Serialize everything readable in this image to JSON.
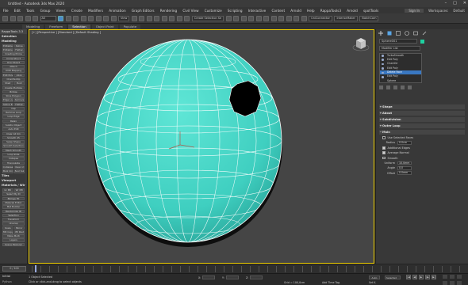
{
  "titlebar": {
    "title": "Untitled - Autodesk 3ds Max 2020"
  },
  "menu": {
    "items": [
      "File",
      "Edit",
      "Tools",
      "Group",
      "Views",
      "Create",
      "Modifiers",
      "Animation",
      "Graph Editors",
      "Rendering",
      "Civil View",
      "Customize",
      "Scripting",
      "Interactive",
      "Content",
      "Arnold",
      "Help",
      "RappaTools3",
      "Arnold",
      "spotTools"
    ],
    "right_items": [
      "Sign In",
      "Workspaces:",
      "Default"
    ]
  },
  "toolbar": {
    "selection_filter": "All",
    "view_combo": "View",
    "selection_set": "Create Selection Se",
    "extra_labels": [
      "UniConnector",
      "InteriorMaker",
      "BatchCam"
    ]
  },
  "ribbon": {
    "tabs": [
      "Modeling",
      "Freeform",
      "Selection",
      "Object Paint",
      "Populate"
    ],
    "active": "Selection"
  },
  "leftpanel": {
    "header": "RappaTools 3.3",
    "selection_title": "Selection",
    "modeling_title": "Modeling",
    "buttons": [
      "Editable Poly",
      "Spline",
      "Editable Mesh",
      "Flatten",
      "Creating Prime",
      "Circle Struct",
      "One Object",
      "Attach",
      "UVW Mapping",
      "Edit Poly",
      "Align",
      "ChamferZip",
      "Shell",
      "Push",
      "Create Multiple",
      "Bridge",
      "Slice Polygon",
      "Edge Loop",
      "Remove Loop",
      "Spline Edge",
      "Flatten",
      "Cap",
      "Remove Loop",
      "Loop Edge",
      "Relax",
      "Subdiv Object",
      "Auto Edit",
      "Clear All Sm",
      "Smooth 45",
      "Swap Shape",
      "Smooth Selection",
      "Mesh Smooth",
      "Loop Slide",
      "Collapse",
      "Triangulate",
      "Collapse",
      "Clean Up",
      "Bool Union",
      "Bool Subtract"
    ],
    "tiles_title": "Tiles",
    "viewport_title": "Viewport",
    "materials_title": "Materials / Wir",
    "mat_buttons": [
      "Gr Mtl",
      "Wr Mtl",
      "Select By ID",
      "Bitmap Fit",
      "Material Editor",
      "Mat Builder",
      "Randomize ID",
      "Selection",
      "Transform",
      "Unwrap",
      "Scale",
      "Mirror",
      "Mtl Copy",
      "Mtl Paste",
      "Make Multi",
      "Layers",
      "Scene Explorer"
    ]
  },
  "viewport": {
    "label": "[+] [Perspective ] [Standard ] [Default Shading ]"
  },
  "rightpanel": {
    "object_name": "Sphere001",
    "object_color": "#1fd0a0",
    "modifier_list": "Modifier List",
    "stack": [
      {
        "name": "TurboSmooth",
        "sel": false,
        "indent": false
      },
      {
        "name": "Edit Poly",
        "sel": false,
        "indent": false
      },
      {
        "name": "Chamfer",
        "sel": false,
        "indent": false
      },
      {
        "name": "Edit Poly",
        "sel": false,
        "indent": false
      },
      {
        "name": "Delete Face",
        "sel": true,
        "indent": false
      },
      {
        "name": "Edit Poly",
        "sel": false,
        "indent": false
      },
      {
        "name": "Sphere",
        "sel": false,
        "indent": true
      }
    ],
    "rollouts": [
      "Shape",
      "About",
      "Subdivision",
      "Outer Loop"
    ],
    "main_rollout": "Main",
    "params": {
      "use_selected_faces": "Use Selected Faces",
      "radius_label": "Radius",
      "radius_value": "0.0cm",
      "additional_edges": "Additional Edges",
      "average_normal": "Average Normal",
      "smooth": "Smooth",
      "uniform_label": "Uniform",
      "uniform_value": "10.0mm",
      "angle_label": "Angle",
      "angle_value": "0.0",
      "offset_label": "Offset",
      "offset_value": "0.0mm"
    }
  },
  "timeline": {
    "slider_label": "0 / 100",
    "frames": [
      "0",
      "5",
      "10",
      "15",
      "20",
      "25",
      "30",
      "35",
      "40",
      "45",
      "50",
      "55",
      "60",
      "65",
      "70",
      "75",
      "80",
      "85",
      "90",
      "95",
      "100"
    ]
  },
  "status": {
    "line1": "Initial",
    "line2": "Python",
    "msg1": "1 Object Selected",
    "msg2": "Click or click-and-drag to select objects",
    "x_label": "X:",
    "y_label": "Y:",
    "z_label": "Z:",
    "grid": "Grid = 100,0cm",
    "add_time_tag": "Add Time Tag",
    "auto_key": "Auto",
    "selected": "Selected",
    "set_key": "Set K.",
    "filters": "Filters..."
  }
}
